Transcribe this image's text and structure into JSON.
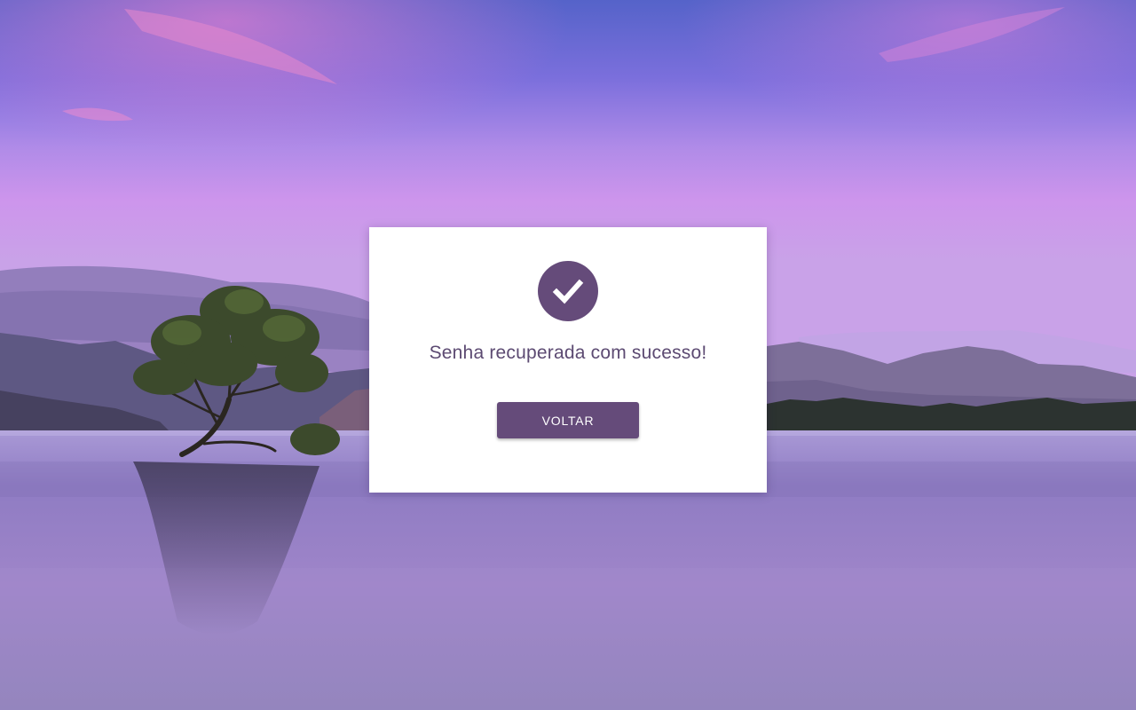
{
  "dialog": {
    "message": "Senha recuperada com sucesso!",
    "back_button_label": "VOLTAR",
    "icon": "check-circle-icon"
  },
  "background": {
    "description_icon": "lake-tree-landscape"
  },
  "colors": {
    "accent": "#654b7a",
    "message_text": "#5c4a72",
    "button_bg": "#654b7a",
    "button_text": "#ffffff",
    "sky_top": "#5f68cf",
    "sky_mid": "#b58cec",
    "water": "#9a83c9"
  }
}
